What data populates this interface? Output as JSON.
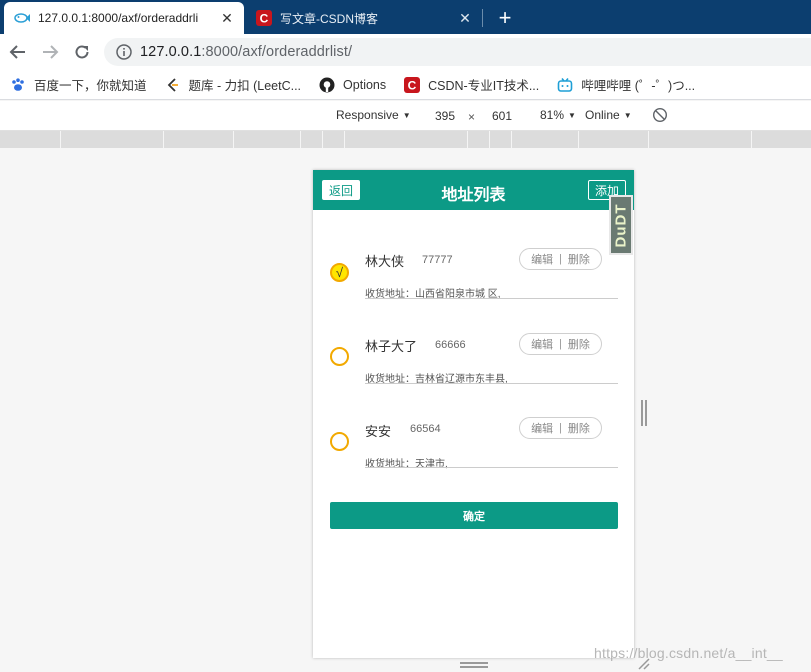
{
  "browser": {
    "tabs": [
      {
        "title": "127.0.0.1:8000/axf/orderaddrli",
        "favicon": "fish-icon",
        "active": true
      },
      {
        "title": "写文章-CSDN博客",
        "favicon": "csdn-icon",
        "active": false
      }
    ],
    "newtab_symbol": "+",
    "close_symbol": "✕",
    "url_host": "127.0.0.1",
    "url_rest": ":8000/axf/orderaddrlist/"
  },
  "bookmarks": [
    {
      "label": "百度一下，你就知道",
      "icon": "paw-icon"
    },
    {
      "label": "题库 - 力扣 (LeetC...",
      "icon": "leetcode-icon"
    },
    {
      "label": "Options",
      "icon": "github-icon"
    },
    {
      "label": "CSDN-专业IT技术...",
      "icon": "csdn-icon"
    },
    {
      "label": "哔哩哔哩 (゜-゜)つ...",
      "icon": "bilibili-icon"
    }
  ],
  "devtools": {
    "device": "Responsive",
    "width": "395",
    "times": "×",
    "height": "601",
    "zoom": "81%",
    "network": "Online"
  },
  "app": {
    "header": {
      "back_label": "返回",
      "title": "地址列表",
      "add_label": "添加"
    },
    "addresses": [
      {
        "name": "林大侠",
        "phone": "77777",
        "address": "收货地址：山西省阳泉市城   区,",
        "checked": true,
        "check_mark": "√"
      },
      {
        "name": "林子大了",
        "phone": "66666",
        "address": "收货地址：吉林省辽源市东丰县,",
        "checked": false,
        "check_mark": ""
      },
      {
        "name": "安安",
        "phone": "66564",
        "address": "收货地址：天津市,",
        "checked": false,
        "check_mark": ""
      }
    ],
    "edit_label": "编辑",
    "divider": "|",
    "delete_label": "删除",
    "confirm_label": "确定"
  },
  "overlay_badge": "DuDT",
  "watermark": "https://blog.csdn.net/a__int__",
  "colors": {
    "brand": "#0c9a86",
    "tabbar": "#0c3e6f",
    "radio_border": "#f2a900",
    "radio_checked": "#ffe600"
  }
}
